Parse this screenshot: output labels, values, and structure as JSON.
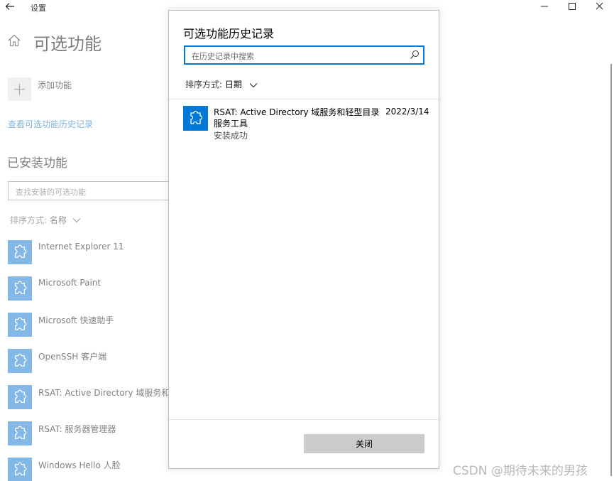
{
  "window": {
    "title": "设置",
    "back_icon": "arrow-left-icon",
    "minimize_icon": "minimize-icon",
    "maximize_icon": "maximize-icon",
    "close_icon": "close-icon"
  },
  "page": {
    "title": "可选功能",
    "home_icon": "home-icon",
    "add_feature_label": "添加功能",
    "history_link": "查看可选功能历史记录",
    "installed_heading": "已安装功能",
    "installed_search_placeholder": "查找安装的可选功能",
    "sort_label": "排序方式:",
    "sort_value": "名称",
    "installed_features": [
      {
        "name": "Internet Explorer 11",
        "icon": "puzzle-icon"
      },
      {
        "name": "Microsoft Paint",
        "icon": "puzzle-icon"
      },
      {
        "name": "Microsoft 快速助手",
        "icon": "puzzle-icon"
      },
      {
        "name": "OpenSSH 客户端",
        "icon": "puzzle-icon"
      },
      {
        "name": "RSAT: Active Directory 域服务和轻型",
        "icon": "puzzle-icon"
      },
      {
        "name": "RSAT: 服务器管理器",
        "icon": "puzzle-icon"
      },
      {
        "name": "Windows Hello 人脸",
        "icon": "puzzle-icon"
      }
    ]
  },
  "dialog": {
    "title": "可选功能历史记录",
    "search_placeholder": "在历史记录中搜索",
    "search_icon": "search-icon",
    "sort_label": "排序方式:",
    "sort_value": "日期",
    "history": [
      {
        "name": "RSAT: Active Directory 域服务和轻型目录服务工具",
        "date": "2022/3/14",
        "status": "安装成功",
        "icon": "puzzle-icon"
      }
    ],
    "close_label": "关闭"
  },
  "watermark": "CSDN @期待未来的男孩",
  "colors": {
    "accent": "#0078d7",
    "link": "#0067b8",
    "button_gray": "#cccccc"
  }
}
